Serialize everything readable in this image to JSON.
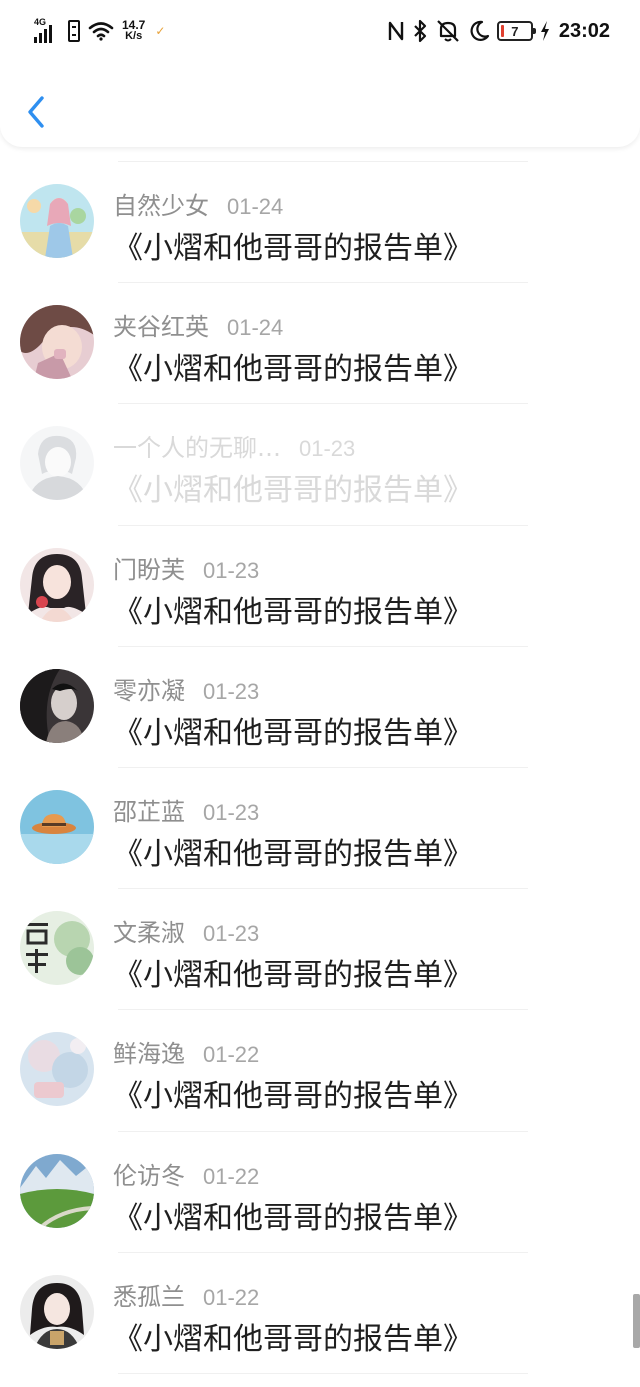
{
  "status_bar": {
    "network": "4G",
    "speed_value": "14.7",
    "speed_unit": "K/s",
    "battery": "7",
    "time": "23:02"
  },
  "nav": {
    "back_icon": "chevron-left-icon"
  },
  "rows": [
    {
      "user": "自然少女",
      "date": "01-24",
      "title": "《小熠和他哥哥的报告单》"
    },
    {
      "user": "夹谷红英",
      "date": "01-24",
      "title": "《小熠和他哥哥的报告单》"
    },
    {
      "user": "一个人的无聊…",
      "date": "01-23",
      "title": "《小熠和他哥哥的报告单》"
    },
    {
      "user": "门盼芙",
      "date": "01-23",
      "title": "《小熠和他哥哥的报告单》"
    },
    {
      "user": "零亦凝",
      "date": "01-23",
      "title": "《小熠和他哥哥的报告单》"
    },
    {
      "user": "邵芷蓝",
      "date": "01-23",
      "title": "《小熠和他哥哥的报告单》"
    },
    {
      "user": "文柔淑",
      "date": "01-23",
      "title": "《小熠和他哥哥的报告单》"
    },
    {
      "user": "鲜海逸",
      "date": "01-22",
      "title": "《小熠和他哥哥的报告单》"
    },
    {
      "user": "伦访冬",
      "date": "01-22",
      "title": "《小熠和他哥哥的报告单》"
    },
    {
      "user": "悉孤兰",
      "date": "01-22",
      "title": "《小熠和他哥哥的报告单》"
    }
  ],
  "colors": {
    "accent": "#2e8ff0",
    "name": "#8f8f8f",
    "date": "#a6a6a6",
    "title": "#1f1f1f",
    "faded": "#d9d9d9"
  }
}
